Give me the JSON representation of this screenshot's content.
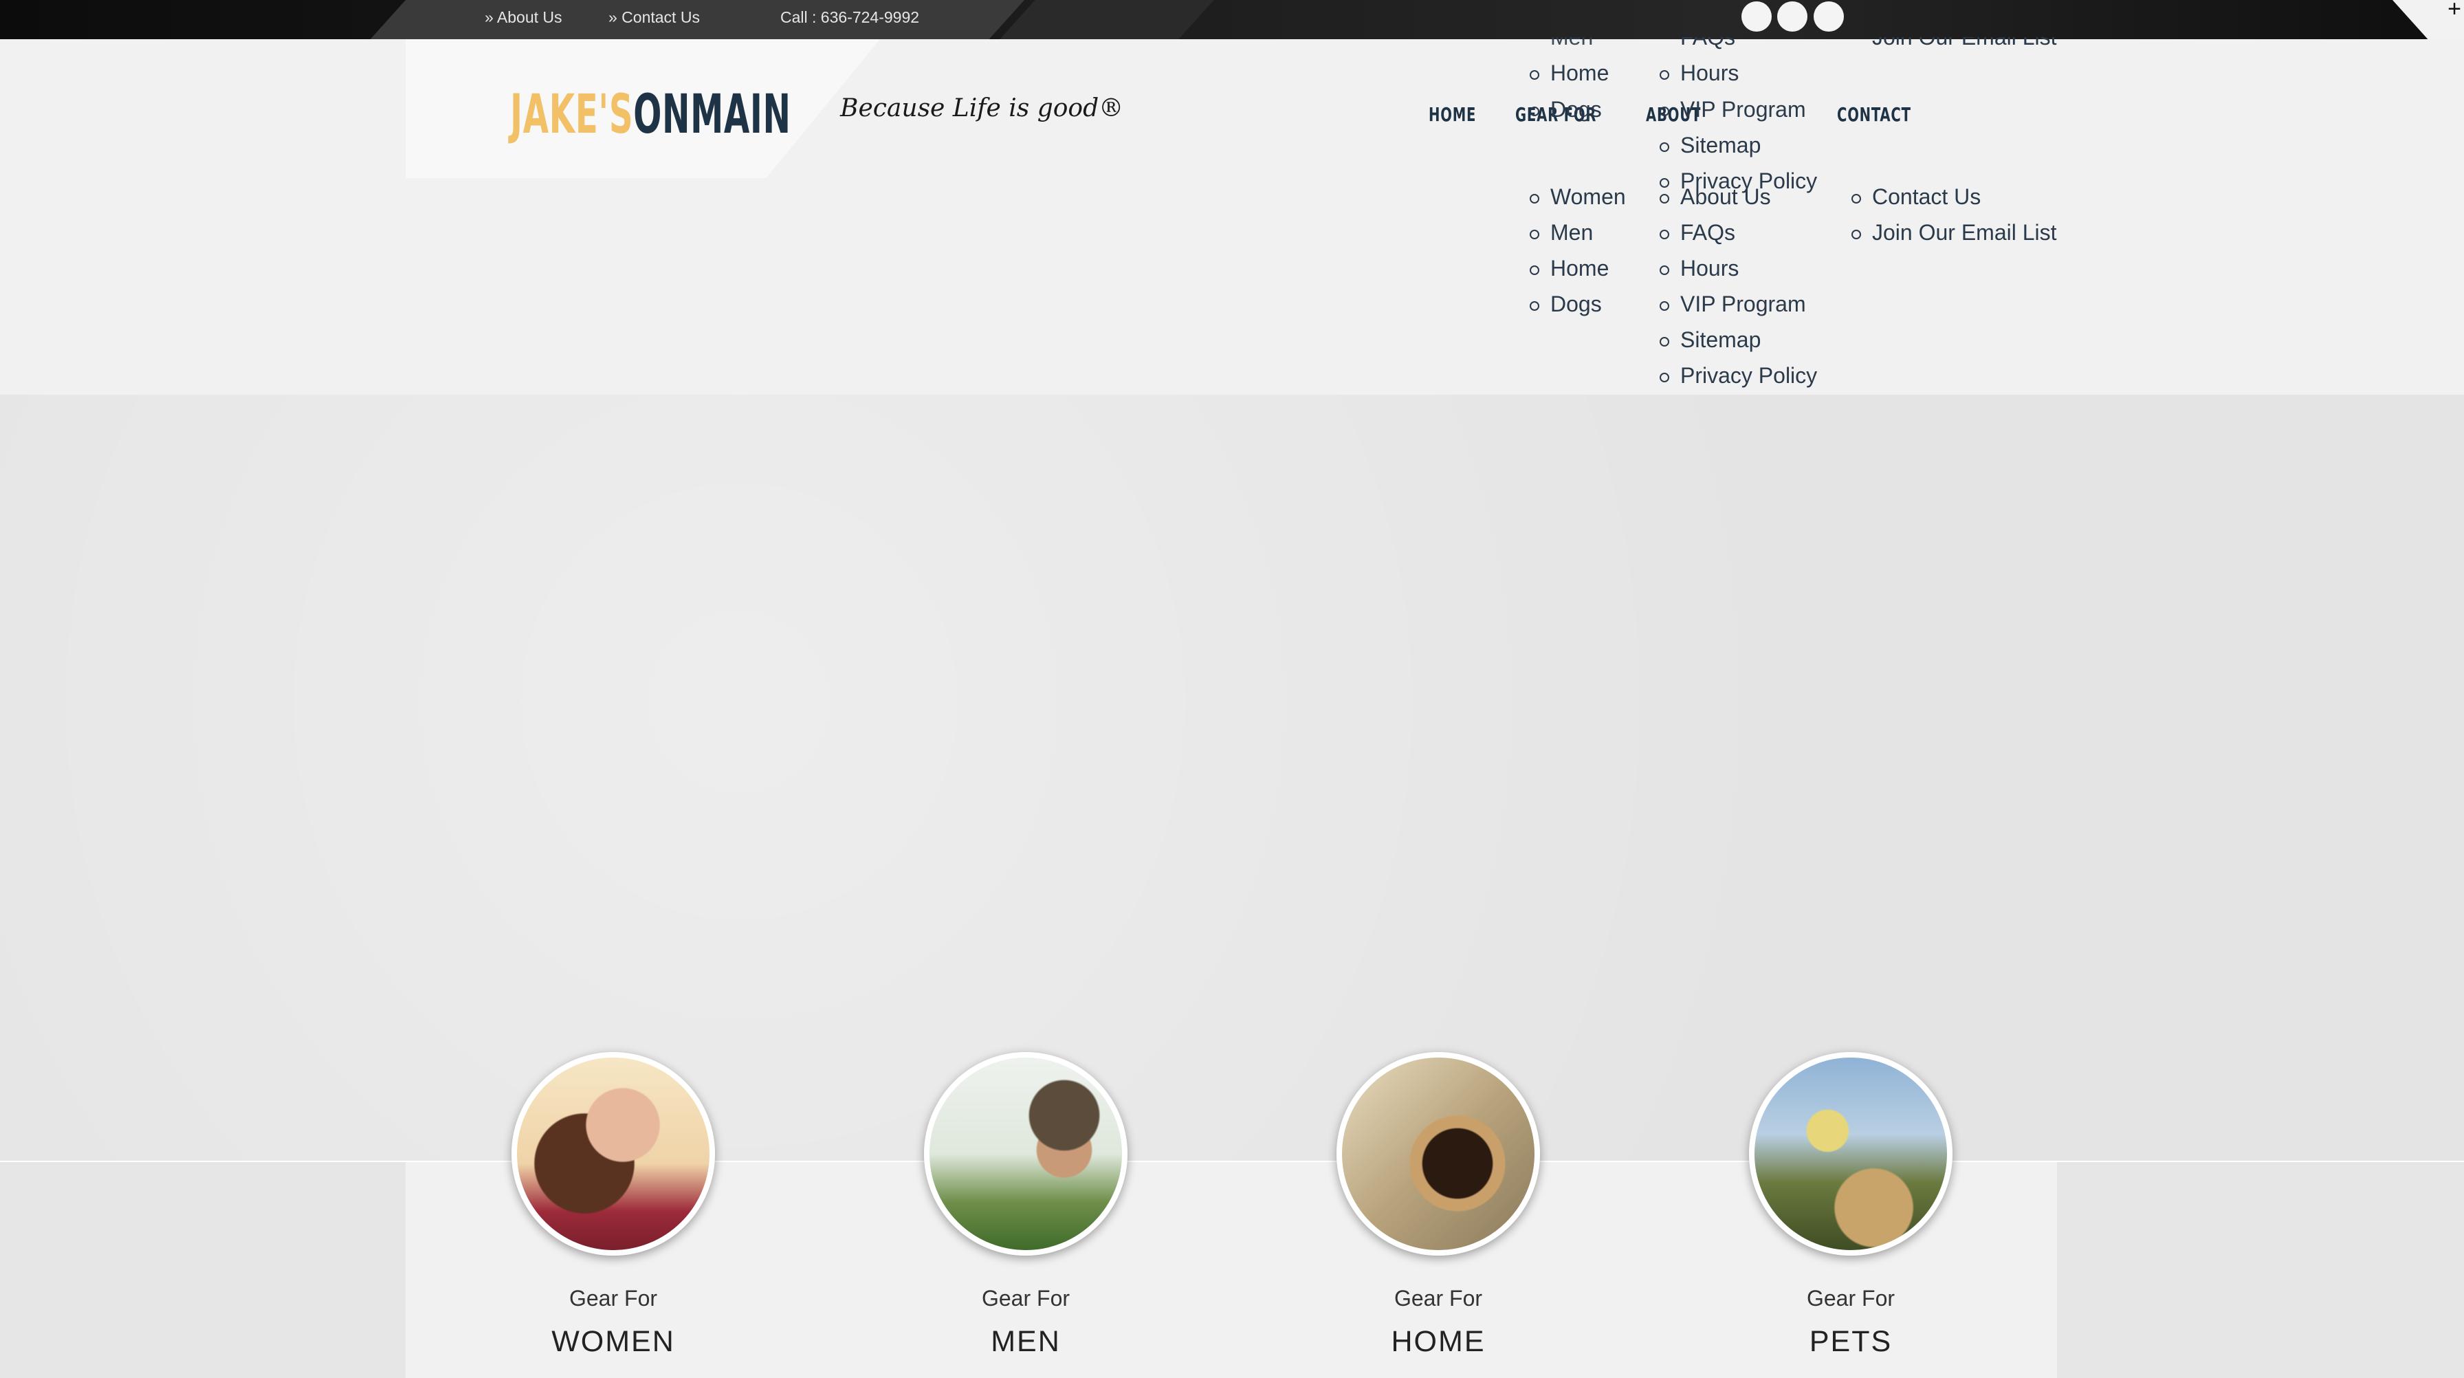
{
  "topbar": {
    "about_link": "» About Us",
    "contact_link": "» Contact Us",
    "phone": "Call : 636-724-9992",
    "social_icons": [
      "facebook-icon",
      "twitter-icon",
      "instagram-icon"
    ]
  },
  "brand": {
    "logo_part1": "JAKE'S",
    "logo_part2": "ONMAIN",
    "tagline": "Because Life is good®",
    "accent_color": "#f2c066",
    "navy_color": "#1f3346"
  },
  "nav": {
    "home": "HOME",
    "gear_for": "GEAR FOR",
    "about": "ABOUT",
    "contact": "CONTACT"
  },
  "menus": {
    "gear_for": [
      "Women",
      "Men",
      "Home",
      "Dogs"
    ],
    "about": [
      "About Us",
      "FAQs",
      "Hours",
      "VIP Program",
      "Sitemap",
      "Privacy Policy"
    ],
    "contact": [
      "Contact Us",
      "Join Our Email List"
    ],
    "ghost_gear_for": [
      "Men",
      "Home",
      "Dogs"
    ],
    "ghost_about": [
      "FAQs",
      "Hours",
      "VIP Program",
      "Sitemap",
      "Privacy Policy"
    ],
    "ghost_contact": [
      "Join Our Email List"
    ]
  },
  "categories": [
    {
      "sub": "Gear For",
      "title": "WOMEN"
    },
    {
      "sub": "Gear For",
      "title": "MEN"
    },
    {
      "sub": "Gear For",
      "title": "HOME"
    },
    {
      "sub": "Gear For",
      "title": "PETS"
    }
  ]
}
